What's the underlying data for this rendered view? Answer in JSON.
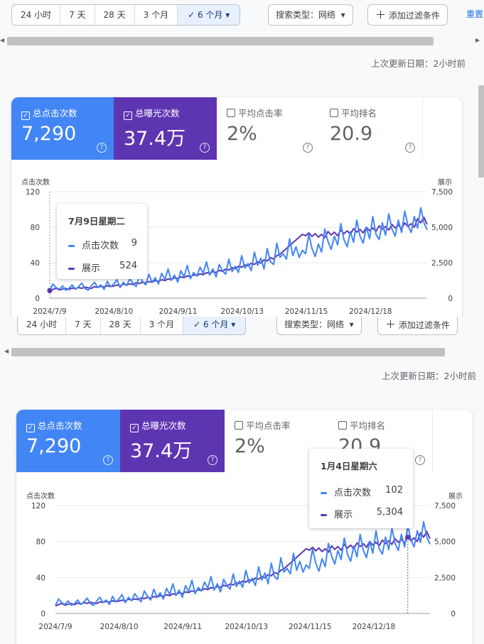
{
  "toolbar": {
    "ranges": [
      "24 小时",
      "7 天",
      "28 天",
      "3 个月",
      "6 个月"
    ],
    "selected_range": "6 个月",
    "search_type": "搜索类型：网络",
    "add_filter": "添加过滤条件",
    "reset": "重置"
  },
  "last_updated": "上次更新日期：2小时前",
  "metrics": [
    {
      "label": "总点击次数",
      "value": "7,290",
      "checked": true
    },
    {
      "label": "总曝光次数",
      "value": "37.4万",
      "checked": true
    },
    {
      "label": "平均点击率",
      "value": "2%",
      "checked": false
    },
    {
      "label": "平均排名",
      "value": "20.9",
      "checked": false
    }
  ],
  "colors": {
    "clicks": "#4285f4",
    "impressions": "#5e35b1",
    "accent": "#1a73e8"
  },
  "tooltips": {
    "top": {
      "date": "7月9日星期二",
      "clicks_label": "点击次数",
      "clicks": "9",
      "impressions_label": "展示",
      "impressions": "524"
    },
    "bottom": {
      "date": "1月4日星期六",
      "clicks_label": "点击次数",
      "clicks": "102",
      "impressions_label": "展示",
      "impressions": "5,304"
    }
  },
  "chart_data": {
    "type": "line",
    "left_axis_label": "点击次数",
    "right_axis_label": "展示",
    "left_ticks": [
      "0",
      "40",
      "80",
      "120"
    ],
    "right_ticks": [
      "0",
      "2,500",
      "5,000",
      "7,500"
    ],
    "ylim_left": [
      0,
      120
    ],
    "ylim_right": [
      0,
      7500
    ],
    "x_tick_labels": [
      "2024/7/9",
      "2024/8/10",
      "2024/9/11",
      "2024/10/13",
      "2024/11/15",
      "2024/12/18"
    ],
    "series": [
      {
        "name": "点击次数",
        "axis": "left",
        "color": "#4285f4",
        "values": [
          9,
          16,
          12,
          10,
          14,
          9,
          11,
          15,
          10,
          13,
          17,
          11,
          9,
          14,
          18,
          12,
          15,
          10,
          19,
          13,
          16,
          21,
          12,
          18,
          14,
          22,
          17,
          13,
          25,
          19,
          15,
          27,
          18,
          23,
          16,
          28,
          21,
          33,
          20,
          26,
          18,
          31,
          24,
          37,
          22,
          29,
          25,
          35,
          28,
          41,
          26,
          33,
          24,
          38,
          31,
          27,
          44,
          30,
          36,
          29,
          48,
          34,
          39,
          31,
          52,
          37,
          45,
          33,
          56,
          41,
          38,
          62,
          46,
          50,
          44,
          67,
          48,
          58,
          46,
          54,
          50,
          72,
          56,
          47,
          61,
          52,
          78,
          64,
          55,
          70,
          60,
          84,
          66,
          58,
          75,
          63,
          88,
          70,
          62,
          80,
          67,
          92,
          72,
          66,
          85,
          71,
          95,
          78,
          70,
          88,
          74,
          98,
          82,
          74,
          92,
          79,
          102,
          85,
          77
        ]
      },
      {
        "name": "展示",
        "axis": "right",
        "color": "#5e35b1",
        "values": [
          524,
          620,
          700,
          580,
          640,
          690,
          610,
          720,
          660,
          750,
          700,
          780,
          730,
          690,
          810,
          760,
          840,
          790,
          880,
          820,
          860,
          930,
          870,
          990,
          940,
          1010,
          960,
          1080,
          1030,
          1120,
          1070,
          1180,
          1120,
          1250,
          1190,
          1300,
          1240,
          1370,
          1310,
          1440,
          1380,
          1500,
          1450,
          1570,
          1510,
          1650,
          1590,
          1720,
          1660,
          1800,
          1740,
          1880,
          1810,
          1960,
          1890,
          2050,
          1980,
          2150,
          2080,
          2250,
          2180,
          2350,
          2280,
          2460,
          2380,
          2560,
          2480,
          2700,
          2620,
          2850,
          2760,
          3000,
          3100,
          3300,
          3500,
          3700,
          3900,
          4100,
          4300,
          4500,
          4400,
          4600,
          4350,
          4550,
          4300,
          4500,
          4250,
          4700,
          4450,
          4650,
          4400,
          4800,
          4550,
          4750,
          4500,
          4900,
          4650,
          4850,
          4600,
          5000,
          4750,
          4950,
          4700,
          5100,
          4850,
          5050,
          4800,
          5200,
          4950,
          5150,
          4900,
          5304,
          5050,
          5250,
          5000,
          5600,
          5304,
          5700,
          5200
        ]
      }
    ]
  }
}
